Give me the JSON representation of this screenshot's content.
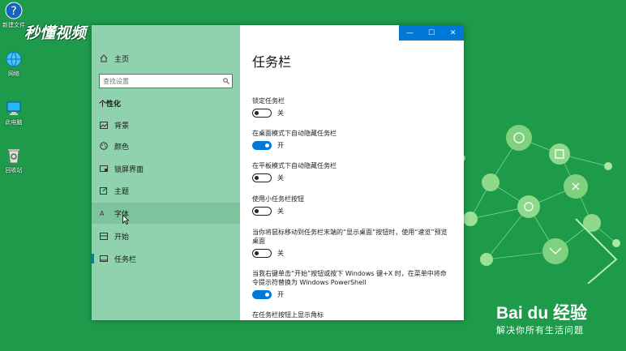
{
  "desktop": {
    "icons": [
      {
        "label": "新建文件",
        "icon": "help-question-icon"
      },
      {
        "label": "网络",
        "icon": "network-icon"
      },
      {
        "label": "此电脑",
        "icon": "computer-icon"
      },
      {
        "label": "回收站",
        "icon": "recycle-bin-icon"
      }
    ],
    "watermark": "秒懂视频",
    "baidu_logo": "Bai du 经验",
    "baidu_slogan": "解决你所有生活问题"
  },
  "window": {
    "controls": {
      "minimize": "—",
      "maximize": "☐",
      "close": "✕"
    },
    "sidebar": {
      "home_label": "主页",
      "search_placeholder": "查找设置",
      "section_title": "个性化",
      "items": [
        {
          "label": "背景",
          "icon": "picture-icon"
        },
        {
          "label": "颜色",
          "icon": "palette-icon"
        },
        {
          "label": "锁屏界面",
          "icon": "lock-screen-icon"
        },
        {
          "label": "主题",
          "icon": "theme-icon"
        },
        {
          "label": "字体",
          "icon": "font-icon"
        },
        {
          "label": "开始",
          "icon": "start-menu-icon"
        },
        {
          "label": "任务栏",
          "icon": "taskbar-icon"
        }
      ]
    },
    "main": {
      "title": "任务栏",
      "settings": [
        {
          "label": "锁定任务栏",
          "state": "关",
          "on": false
        },
        {
          "label": "在桌面模式下自动隐藏任务栏",
          "state": "开",
          "on": true
        },
        {
          "label": "在平板模式下自动隐藏任务栏",
          "state": "关",
          "on": false
        },
        {
          "label": "使用小任务栏按钮",
          "state": "关",
          "on": false
        },
        {
          "label": "当你将鼠标移动到任务栏末端的“显示桌面”按钮时，使用“速览”预览桌面",
          "state": "关",
          "on": false
        },
        {
          "label": "当我右键单击“开始”按钮或按下 Windows 键+X 时，在菜单中将命令提示符替换为 Windows PowerShell",
          "state": "开",
          "on": true
        },
        {
          "label": "在任务栏按钮上显示角标",
          "state": "",
          "on": false
        }
      ]
    }
  },
  "colors": {
    "accent": "#0078d7",
    "sidebar": "#8fd2ad",
    "desktop": "#1e9a4b"
  }
}
